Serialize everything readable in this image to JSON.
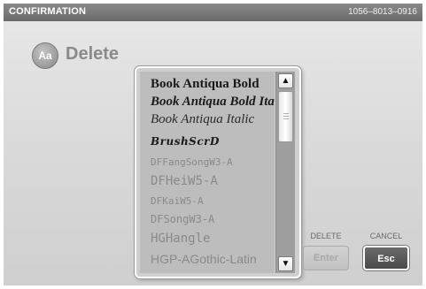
{
  "titlebar": {
    "title": "CONFIRMATION",
    "serial": "1056–8013–0916"
  },
  "heading": {
    "icon_text": "Aa",
    "label": "Delete"
  },
  "font_list": {
    "items": [
      "Book Antiqua Bold",
      "Book Antiqua Bold Italic",
      "Book Antiqua Italic",
      "BrushScrD",
      "DFFangSongW3-A",
      "DFHeiW5-A",
      "DFKaiW5-A",
      "DFSongW3-A",
      "HGHangle",
      "HGP-AGothic-Latin"
    ]
  },
  "buttons": {
    "delete_caption": "DELETE",
    "enter_label": "Enter",
    "cancel_caption": "CANCEL",
    "esc_label": "Esc"
  },
  "icons": {
    "scroll_up": "▲",
    "scroll_down": "▼"
  }
}
